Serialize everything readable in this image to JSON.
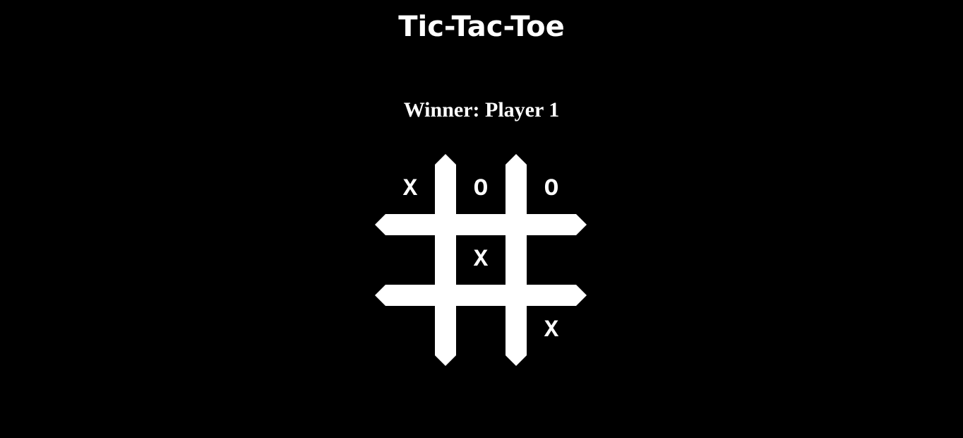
{
  "title": "Tic-Tac-Toe",
  "status": "Winner: Player 1",
  "board": [
    "X",
    "O",
    "O",
    "",
    "X",
    "",
    "",
    "",
    "X"
  ],
  "colors": {
    "background": "#000000",
    "foreground": "#ffffff"
  }
}
